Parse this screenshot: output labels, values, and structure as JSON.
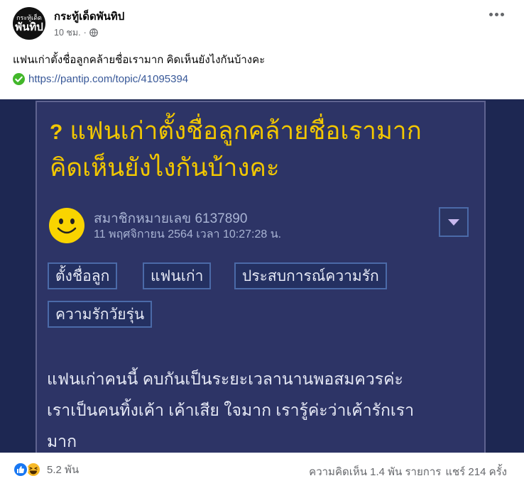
{
  "post": {
    "page_name": "กระทู้เด็ดพันทิป",
    "avatar_line1": "กระทู้เด็ด",
    "avatar_line2": "พันทิป",
    "time": "10 ชม.",
    "separator": "·",
    "privacy_icon": "globe-icon",
    "text": "แฟนเก่าตั้งชื่อลูกคล้ายชื่อเรามาก คิดเห็นยังไงกันบ้างคะ",
    "link_icon": "green-check-icon",
    "link_url": "https://pantip.com/topic/41095394"
  },
  "preview": {
    "question_icon": "?",
    "title_line1": "แฟนเก่าตั้งชื่อลูกคล้ายชื่อเรามาก",
    "title_line2": "คิดเห็นยังไงกันบ้างคะ",
    "avatar_icon": "smiley-icon",
    "member": "สมาชิกหมายเลข 6137890",
    "date": "11 พฤศจิกายน 2564 เวลา 10:27:28 น.",
    "tags": [
      "ตั้งชื่อลูก",
      "แฟนเก่า",
      "ประสบการณ์ความรัก",
      "ความรักวัยรุ่น"
    ],
    "body_line1": "แฟนเก่าคนนี้ คบกันเป็นระยะเวลานานพอสมควรค่ะ",
    "body_line2": "เราเป็นคนทิ้งเค้า เค้าเสีย ใจมาก เรารู้ค่ะว่าเค้ารักเรา",
    "body_line3": "มาก"
  },
  "footer": {
    "reaction_icons": [
      "like-icon",
      "haha-icon"
    ],
    "reaction_count": "5.2 พัน",
    "comments": "ความคิดเห็น 1.4 พัน รายการ",
    "shares": "แชร์ 214 ครั้ง"
  },
  "colors": {
    "preview_bg": "#1d2752",
    "title_yellow": "#f2c700",
    "link_blue": "#385898",
    "like_blue": "#1877f2",
    "haha_yellow": "#f7b928",
    "check_green": "#42b72a"
  }
}
